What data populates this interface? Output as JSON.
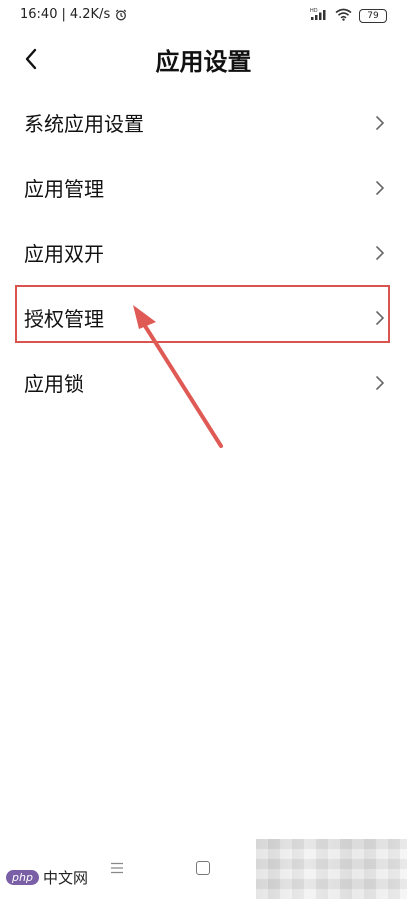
{
  "status_bar": {
    "time": "16:40",
    "separator": "|",
    "speed": "4.2K/s",
    "alarm_icon": "alarm-clock-icon",
    "signal_label": "HD",
    "signal_icon": "cell-signal-icon",
    "wifi_icon": "wifi-icon",
    "battery": "79"
  },
  "header": {
    "back_icon": "chevron-left-icon",
    "title": "应用设置"
  },
  "list": [
    {
      "label": "系统应用设置"
    },
    {
      "label": "应用管理"
    },
    {
      "label": "应用双开"
    },
    {
      "label": "授权管理"
    },
    {
      "label": "应用锁"
    }
  ],
  "highlight": {
    "target_index": 3,
    "color": "#d9534f"
  },
  "nav_bar": {
    "menu_icon": "menu-icon",
    "home_icon": "home-square-icon"
  },
  "watermark": {
    "badge": "php",
    "text": "中文网"
  }
}
